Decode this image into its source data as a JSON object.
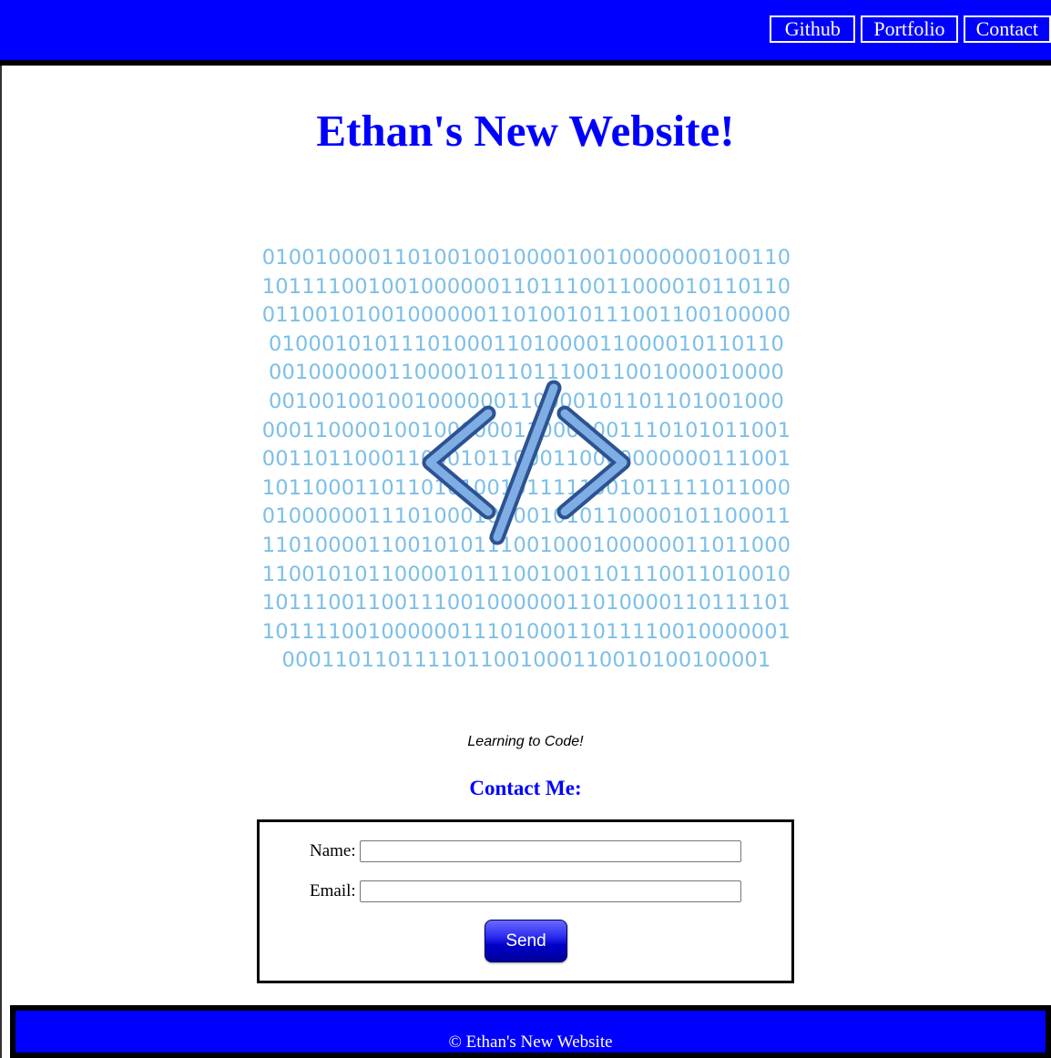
{
  "header": {
    "nav": [
      {
        "label": "Github"
      },
      {
        "label": "Portfolio"
      },
      {
        "label": "Contact"
      }
    ]
  },
  "main": {
    "title": "Ethan's New Website!",
    "hero_binary": [
      "0100100001101001001000010010000000100110",
      "1011110010010000001101110011000010110110",
      "0110010100100000011010010111001100100000",
      "010001010111010001101000011000010110110",
      "001000000110000101101110011001000010000",
      "001001001001000000110000101101101001000",
      "0001100001001000000110000001110101011001",
      "0011011000110001011000110000000000111001",
      "1011000110110101001011111001011111011000",
      "0100000011101000101001010110000101100011",
      "1101000011001010111001000100000011011000",
      "1100101011000010111001001101110011010010",
      "1011100110011100100000011010000110111101",
      "1011110010000001110100011011110010000001",
      "0001101101111011001000110010100100001"
    ],
    "caption": "Learning to Code!",
    "contact_heading": "Contact Me:"
  },
  "form": {
    "name_label": "Name:",
    "name_value": "",
    "email_label": "Email:",
    "email_value": "",
    "send_label": "Send"
  },
  "footer": {
    "text": "© Ethan's New Website"
  },
  "colors": {
    "brand_blue": "#0000ff",
    "binary_text": "#7cbfe8",
    "code_icon_fill": "#7eaee4",
    "code_icon_stroke": "#2d5291"
  },
  "icons": {
    "hero_icon": "code-brackets-icon"
  }
}
